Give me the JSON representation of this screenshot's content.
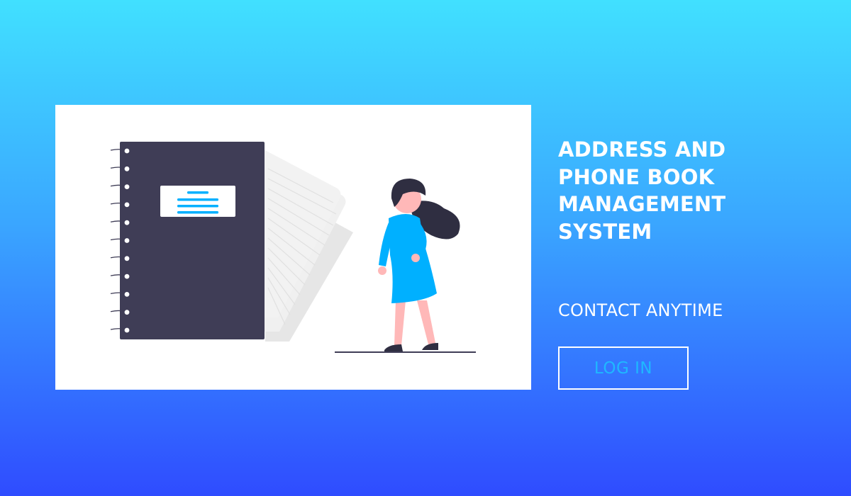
{
  "hero": {
    "title": "ADDRESS AND PHONE BOOK MANAGEMENT SYSTEM",
    "tagline": "CONTACT ANYTIME",
    "login_label": "LOG IN"
  },
  "colors": {
    "gradient_top": "#41e0ff",
    "gradient_bottom": "#2f4cff",
    "notebook_cover": "#3f3d56",
    "accent_blue": "#00b0ff",
    "button_text": "#1fb8ff"
  },
  "illustration": {
    "icons": [
      "spiral-notebook-icon",
      "paper-pages-icon",
      "woman-figure-icon"
    ]
  }
}
